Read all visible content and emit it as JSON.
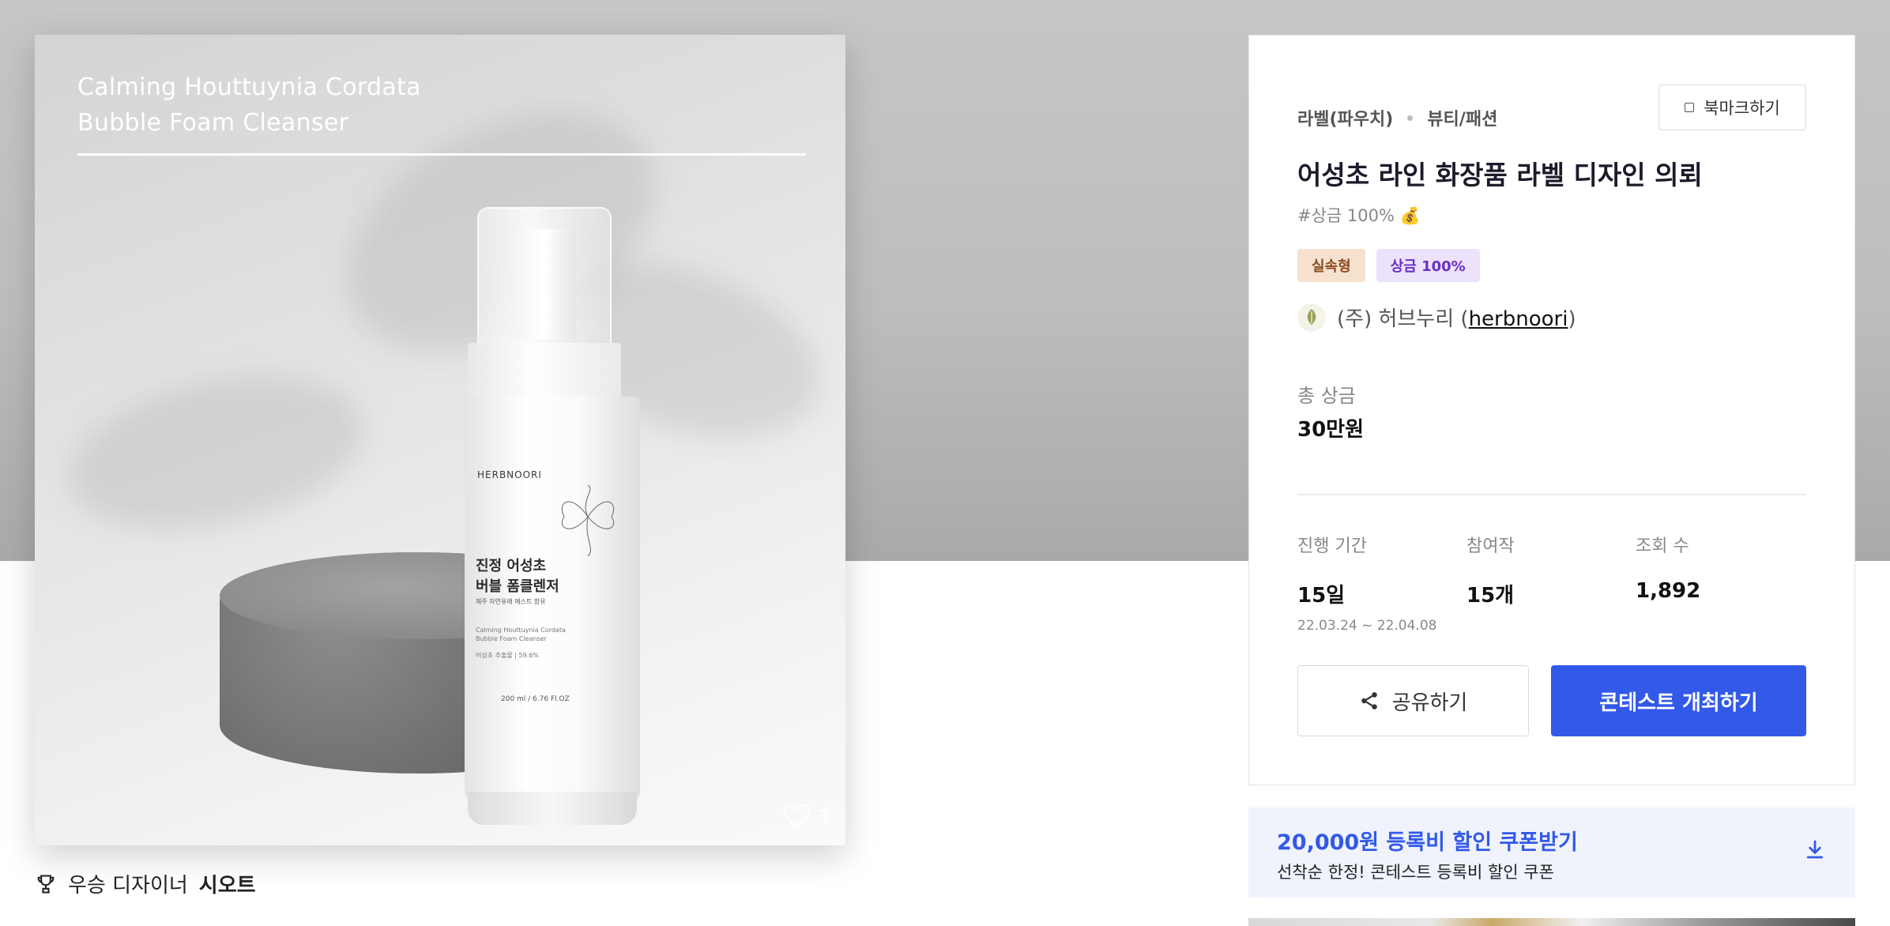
{
  "product_image": {
    "caption_line1": "Calming Houttuynia Cordata",
    "caption_line2": "Bubble Foam Cleanser",
    "bottle_brand": "HERBNOORI",
    "bottle_name_line1": "진정 어성초",
    "bottle_name_line2": "버블 폼클렌저",
    "bottle_sub": "제주 자연유래 에스트 함유",
    "bottle_en_line1": "Calming Houttuynia Cordata",
    "bottle_en_line2": "Bubble Foam Cleanser",
    "bottle_concentration": "어성초 추출물 | 59.6%",
    "bottle_volume": "200 ml / 6.76 Fl.OZ",
    "like_count": "3"
  },
  "winner": {
    "label": "우승 디자이너",
    "name": "시오트"
  },
  "contest": {
    "bookmark_label": "북마크하기",
    "category": "라벨(파우치)",
    "subcategory": "뷰티/패션",
    "title": "어성초 라인 화장품 라벨 디자인 의뢰",
    "hashtag": "#상금 100% 💰",
    "badges": [
      "실속형",
      "상금 100%"
    ],
    "host_name": "(주) 허브누리 (",
    "host_handle": "herbnoori",
    "host_close": ")",
    "prize_label": "총 상금",
    "prize_value": "30만원",
    "stats": {
      "period_label": "진행 기간",
      "period_value": "15일",
      "period_range": "22.03.24 ~ 22.04.08",
      "participants_label": "참여작",
      "participants_value": "15개",
      "views_label": "조회 수",
      "views_value": "1,892"
    },
    "share_label": "공유하기",
    "host_contest_label": "콘테스트 개최하기"
  },
  "coupon": {
    "title": "20,000원 등록비 할인 쿠폰받기",
    "subtitle": "선착순 한정! 콘테스트 등록비 할인 쿠폰"
  },
  "colors": {
    "accent": "#3259e8",
    "badge_type_bg": "#f6e1cf",
    "badge_prize_bg": "#ece2fb",
    "coupon_bg": "#f0f3fc"
  }
}
